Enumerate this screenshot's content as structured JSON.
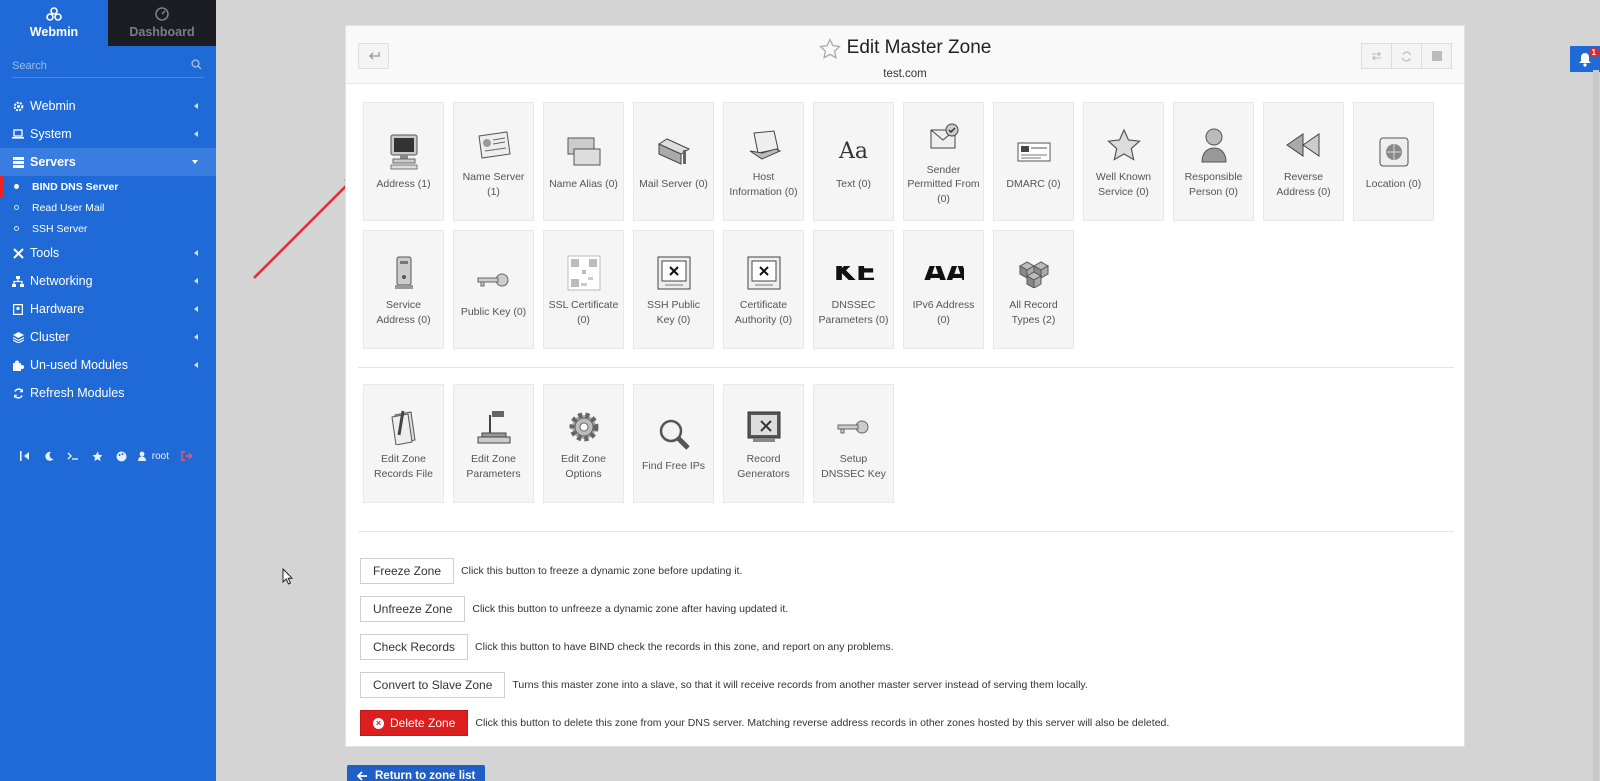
{
  "sidebar": {
    "tabs": [
      {
        "label": "Webmin",
        "icon": "webmin-logo-icon"
      },
      {
        "label": "Dashboard",
        "icon": "dashboard-gauge-icon"
      }
    ],
    "search_placeholder": "Search",
    "menu": [
      {
        "label": "Webmin",
        "icon": "gear-icon"
      },
      {
        "label": "System",
        "icon": "laptop-icon"
      },
      {
        "label": "Servers",
        "icon": "server-stack-icon"
      },
      {
        "label": "Tools",
        "icon": "tools-icon"
      },
      {
        "label": "Networking",
        "icon": "network-icon"
      },
      {
        "label": "Hardware",
        "icon": "hard-drive-icon"
      },
      {
        "label": "Cluster",
        "icon": "layers-icon"
      },
      {
        "label": "Un-used Modules",
        "icon": "puzzle-icon"
      },
      {
        "label": "Refresh Modules",
        "icon": "refresh-icon"
      }
    ],
    "sub_items": [
      "BIND DNS Server",
      "Read User Mail",
      "SSH Server"
    ],
    "bottom_user": "root"
  },
  "header": {
    "title": "Edit Master Zone",
    "subtitle": "test.com"
  },
  "record_tiles": [
    {
      "label": "Address (1)",
      "icon": "computer-icon"
    },
    {
      "label": "Name Server (1)",
      "icon": "name-server-card-icon"
    },
    {
      "label": "Name Alias (0)",
      "icon": "name-alias-windows-icon"
    },
    {
      "label": "Mail Server (0)",
      "icon": "mailbox-icon"
    },
    {
      "label": "Host Information (0)",
      "icon": "laptop-info-icon"
    },
    {
      "label": "Text (0)",
      "icon": "text-aa-icon",
      "glyph": "Aa"
    },
    {
      "label": "Sender Permitted From (0)",
      "icon": "envelope-check-icon"
    },
    {
      "label": "DMARC (0)",
      "icon": "dmarc-card-icon"
    },
    {
      "label": "Well Known Service (0)",
      "icon": "star-icon"
    },
    {
      "label": "Responsible Person (0)",
      "icon": "person-icon"
    },
    {
      "label": "Reverse Address (0)",
      "icon": "rewind-icon"
    },
    {
      "label": "Location (0)",
      "icon": "globe-box-icon"
    },
    {
      "label": "Service Address (0)",
      "icon": "service-tower-icon"
    },
    {
      "label": "Public Key (0)",
      "icon": "key-icon"
    },
    {
      "label": "SSL Certificate (0)",
      "icon": "certificate-qr-icon"
    },
    {
      "label": "SSH Public Key (0)",
      "icon": "ssh-key-box-icon"
    },
    {
      "label": "Certificate Authority (0)",
      "icon": "authority-box-icon"
    },
    {
      "label": "DNSSEC Parameters (0)",
      "icon": "dnssec-ke-icon",
      "glyph": "KE"
    },
    {
      "label": "IPv6 Address (0)",
      "icon": "ipv6-aaaa-icon",
      "glyph": "AA"
    },
    {
      "label": "All Record Types (2)",
      "icon": "cubes-icon"
    }
  ],
  "tool_tiles": [
    {
      "label": "Edit Zone Records File",
      "icon": "edit-file-icon"
    },
    {
      "label": "Edit Zone Parameters",
      "icon": "projector-icon"
    },
    {
      "label": "Edit Zone Options",
      "icon": "cog-options-icon"
    },
    {
      "label": "Find Free IPs",
      "icon": "magnifier-icon"
    },
    {
      "label": "Record Generators",
      "icon": "generator-icon"
    },
    {
      "label": "Setup DNSSEC Key",
      "icon": "setup-key-icon"
    }
  ],
  "actions": [
    {
      "button": "Freeze Zone",
      "desc": "Click this button to freeze a dynamic zone before updating it."
    },
    {
      "button": "Unfreeze Zone",
      "desc": "Click this button to unfreeze a dynamic zone after having updated it."
    },
    {
      "button": "Check Records",
      "desc": "Click this button to have BIND check the records in this zone, and report on any problems."
    },
    {
      "button": "Convert to Slave Zone",
      "desc": "Turns this master zone into a slave, so that it will receive records from another master server instead of serving them locally."
    },
    {
      "button": "Delete Zone",
      "desc": "Click this button to delete this zone from your DNS server. Matching reverse address records in other zones hosted by this server will also be deleted.",
      "danger": true
    }
  ],
  "return_button": "Return to zone list",
  "notification_count": "1",
  "colors": {
    "sidebar": "#1f6ad6",
    "danger": "#dc1e1e",
    "accent": "#1f5fc6"
  }
}
